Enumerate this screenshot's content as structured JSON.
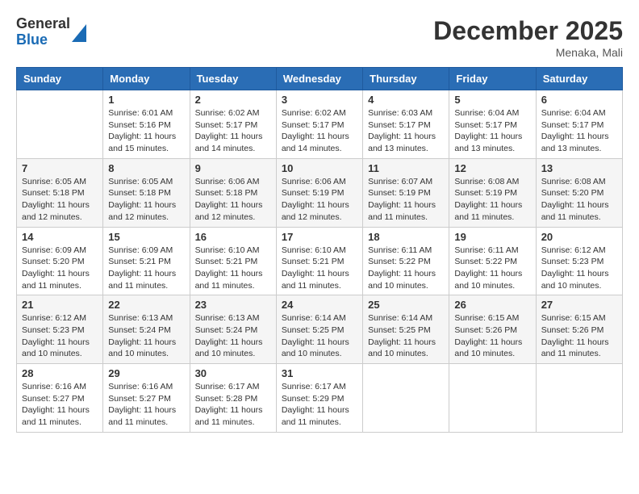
{
  "header": {
    "logo": {
      "general": "General",
      "blue": "Blue"
    },
    "title": "December 2025",
    "location": "Menaka, Mali"
  },
  "calendar": {
    "days_of_week": [
      "Sunday",
      "Monday",
      "Tuesday",
      "Wednesday",
      "Thursday",
      "Friday",
      "Saturday"
    ],
    "weeks": [
      [
        {
          "day": "",
          "sunrise": "",
          "sunset": "",
          "daylight": ""
        },
        {
          "day": "1",
          "sunrise": "Sunrise: 6:01 AM",
          "sunset": "Sunset: 5:16 PM",
          "daylight": "Daylight: 11 hours and 15 minutes."
        },
        {
          "day": "2",
          "sunrise": "Sunrise: 6:02 AM",
          "sunset": "Sunset: 5:17 PM",
          "daylight": "Daylight: 11 hours and 14 minutes."
        },
        {
          "day": "3",
          "sunrise": "Sunrise: 6:02 AM",
          "sunset": "Sunset: 5:17 PM",
          "daylight": "Daylight: 11 hours and 14 minutes."
        },
        {
          "day": "4",
          "sunrise": "Sunrise: 6:03 AM",
          "sunset": "Sunset: 5:17 PM",
          "daylight": "Daylight: 11 hours and 13 minutes."
        },
        {
          "day": "5",
          "sunrise": "Sunrise: 6:04 AM",
          "sunset": "Sunset: 5:17 PM",
          "daylight": "Daylight: 11 hours and 13 minutes."
        },
        {
          "day": "6",
          "sunrise": "Sunrise: 6:04 AM",
          "sunset": "Sunset: 5:17 PM",
          "daylight": "Daylight: 11 hours and 13 minutes."
        }
      ],
      [
        {
          "day": "7",
          "sunrise": "Sunrise: 6:05 AM",
          "sunset": "Sunset: 5:18 PM",
          "daylight": "Daylight: 11 hours and 12 minutes."
        },
        {
          "day": "8",
          "sunrise": "Sunrise: 6:05 AM",
          "sunset": "Sunset: 5:18 PM",
          "daylight": "Daylight: 11 hours and 12 minutes."
        },
        {
          "day": "9",
          "sunrise": "Sunrise: 6:06 AM",
          "sunset": "Sunset: 5:18 PM",
          "daylight": "Daylight: 11 hours and 12 minutes."
        },
        {
          "day": "10",
          "sunrise": "Sunrise: 6:06 AM",
          "sunset": "Sunset: 5:19 PM",
          "daylight": "Daylight: 11 hours and 12 minutes."
        },
        {
          "day": "11",
          "sunrise": "Sunrise: 6:07 AM",
          "sunset": "Sunset: 5:19 PM",
          "daylight": "Daylight: 11 hours and 11 minutes."
        },
        {
          "day": "12",
          "sunrise": "Sunrise: 6:08 AM",
          "sunset": "Sunset: 5:19 PM",
          "daylight": "Daylight: 11 hours and 11 minutes."
        },
        {
          "day": "13",
          "sunrise": "Sunrise: 6:08 AM",
          "sunset": "Sunset: 5:20 PM",
          "daylight": "Daylight: 11 hours and 11 minutes."
        }
      ],
      [
        {
          "day": "14",
          "sunrise": "Sunrise: 6:09 AM",
          "sunset": "Sunset: 5:20 PM",
          "daylight": "Daylight: 11 hours and 11 minutes."
        },
        {
          "day": "15",
          "sunrise": "Sunrise: 6:09 AM",
          "sunset": "Sunset: 5:21 PM",
          "daylight": "Daylight: 11 hours and 11 minutes."
        },
        {
          "day": "16",
          "sunrise": "Sunrise: 6:10 AM",
          "sunset": "Sunset: 5:21 PM",
          "daylight": "Daylight: 11 hours and 11 minutes."
        },
        {
          "day": "17",
          "sunrise": "Sunrise: 6:10 AM",
          "sunset": "Sunset: 5:21 PM",
          "daylight": "Daylight: 11 hours and 11 minutes."
        },
        {
          "day": "18",
          "sunrise": "Sunrise: 6:11 AM",
          "sunset": "Sunset: 5:22 PM",
          "daylight": "Daylight: 11 hours and 10 minutes."
        },
        {
          "day": "19",
          "sunrise": "Sunrise: 6:11 AM",
          "sunset": "Sunset: 5:22 PM",
          "daylight": "Daylight: 11 hours and 10 minutes."
        },
        {
          "day": "20",
          "sunrise": "Sunrise: 6:12 AM",
          "sunset": "Sunset: 5:23 PM",
          "daylight": "Daylight: 11 hours and 10 minutes."
        }
      ],
      [
        {
          "day": "21",
          "sunrise": "Sunrise: 6:12 AM",
          "sunset": "Sunset: 5:23 PM",
          "daylight": "Daylight: 11 hours and 10 minutes."
        },
        {
          "day": "22",
          "sunrise": "Sunrise: 6:13 AM",
          "sunset": "Sunset: 5:24 PM",
          "daylight": "Daylight: 11 hours and 10 minutes."
        },
        {
          "day": "23",
          "sunrise": "Sunrise: 6:13 AM",
          "sunset": "Sunset: 5:24 PM",
          "daylight": "Daylight: 11 hours and 10 minutes."
        },
        {
          "day": "24",
          "sunrise": "Sunrise: 6:14 AM",
          "sunset": "Sunset: 5:25 PM",
          "daylight": "Daylight: 11 hours and 10 minutes."
        },
        {
          "day": "25",
          "sunrise": "Sunrise: 6:14 AM",
          "sunset": "Sunset: 5:25 PM",
          "daylight": "Daylight: 11 hours and 10 minutes."
        },
        {
          "day": "26",
          "sunrise": "Sunrise: 6:15 AM",
          "sunset": "Sunset: 5:26 PM",
          "daylight": "Daylight: 11 hours and 10 minutes."
        },
        {
          "day": "27",
          "sunrise": "Sunrise: 6:15 AM",
          "sunset": "Sunset: 5:26 PM",
          "daylight": "Daylight: 11 hours and 11 minutes."
        }
      ],
      [
        {
          "day": "28",
          "sunrise": "Sunrise: 6:16 AM",
          "sunset": "Sunset: 5:27 PM",
          "daylight": "Daylight: 11 hours and 11 minutes."
        },
        {
          "day": "29",
          "sunrise": "Sunrise: 6:16 AM",
          "sunset": "Sunset: 5:27 PM",
          "daylight": "Daylight: 11 hours and 11 minutes."
        },
        {
          "day": "30",
          "sunrise": "Sunrise: 6:17 AM",
          "sunset": "Sunset: 5:28 PM",
          "daylight": "Daylight: 11 hours and 11 minutes."
        },
        {
          "day": "31",
          "sunrise": "Sunrise: 6:17 AM",
          "sunset": "Sunset: 5:29 PM",
          "daylight": "Daylight: 11 hours and 11 minutes."
        },
        {
          "day": "",
          "sunrise": "",
          "sunset": "",
          "daylight": ""
        },
        {
          "day": "",
          "sunrise": "",
          "sunset": "",
          "daylight": ""
        },
        {
          "day": "",
          "sunrise": "",
          "sunset": "",
          "daylight": ""
        }
      ]
    ]
  }
}
